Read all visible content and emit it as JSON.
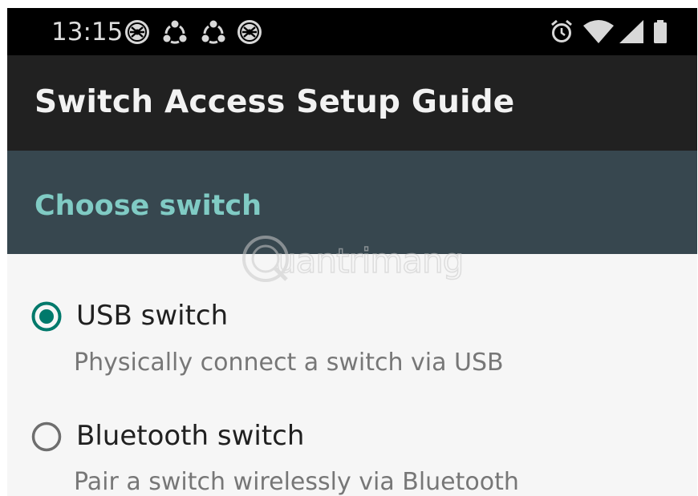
{
  "status_bar": {
    "time": "13:15",
    "notification_icons": [
      "spider-badge-icon",
      "recycle-icon",
      "recycle-icon",
      "spider-badge-icon"
    ],
    "system_icons": [
      "alarm-icon",
      "wifi-icon",
      "signal-icon",
      "battery-icon"
    ]
  },
  "app_bar": {
    "title": "Switch Access Setup Guide"
  },
  "section": {
    "title": "Choose switch"
  },
  "watermark": {
    "text": "uantrimang"
  },
  "options": [
    {
      "label": "USB switch",
      "description": "Physically connect a switch via USB",
      "selected": true
    },
    {
      "label": "Bluetooth switch",
      "description": "Pair a switch wirelessly via Bluetooth",
      "selected": false
    }
  ],
  "colors": {
    "status_bar": "#000000",
    "app_bar": "#212121",
    "section_header": "#37474f",
    "accent": "#00796b",
    "section_title": "#80cbc4"
  }
}
